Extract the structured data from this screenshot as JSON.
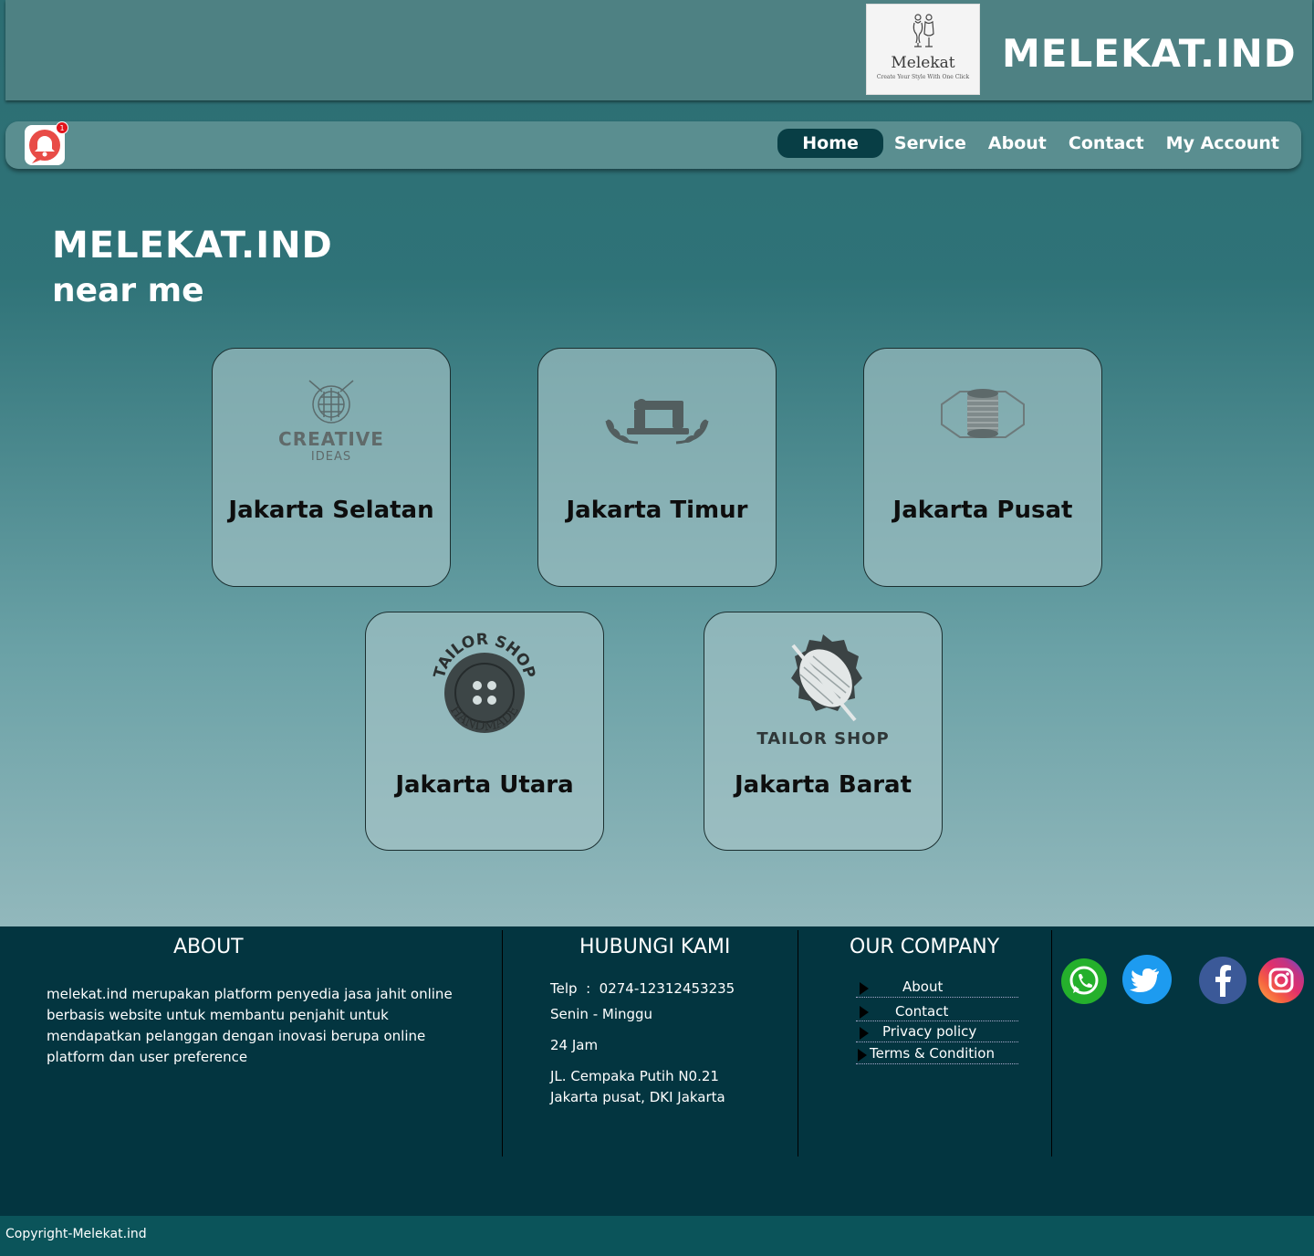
{
  "header": {
    "logo_name": "Melekat",
    "logo_tagline": "Create Your Style With One Click",
    "brand": "MELEKAT.IND"
  },
  "app": {
    "badge_count": "1"
  },
  "nav": {
    "items": [
      {
        "label": "Home",
        "active": true
      },
      {
        "label": "Service"
      },
      {
        "label": "About"
      },
      {
        "label": "Contact"
      },
      {
        "label": "My Account"
      }
    ]
  },
  "hero": {
    "title": "MELEKAT.IND",
    "subtitle": "near me"
  },
  "cards": [
    {
      "title": "Jakarta Selatan",
      "logo_text_1": "CREATIVE",
      "logo_text_2": "IDEAS"
    },
    {
      "title": "Jakarta Timur"
    },
    {
      "title": "Jakarta Pusat"
    },
    {
      "title": "Jakarta Utara",
      "logo_text_1": "TAILOR SHOP",
      "logo_text_2": "HANDMADE"
    },
    {
      "title": "Jakarta Barat",
      "logo_text_1": "TAILOR SHOP"
    }
  ],
  "footer": {
    "about": {
      "heading": "ABOUT",
      "text": "melekat.ind merupakan platform penyedia jasa jahit online berbasis website untuk membantu penjahit untuk mendapatkan pelanggan dengan inovasi berupa online platform dan user preference"
    },
    "contact": {
      "heading": "HUBUNGI KAMI",
      "phone": "Telp  :  0274-12312453235",
      "days": "Senin - Minggu",
      "hours": "24 Jam",
      "address_1": "JL. Cempaka Putih N0.21",
      "address_2": "Jakarta pusat, DKI Jakarta"
    },
    "company": {
      "heading": "OUR COMPANY",
      "links": [
        "About",
        "Contact",
        "Privacy policy",
        "Terms & Condition"
      ]
    },
    "social": [
      "whatsapp-icon",
      "twitter-icon",
      "facebook-icon",
      "instagram-icon"
    ],
    "copyright": "Copyright-Melekat.ind"
  },
  "colors": {
    "header_bg": "#4e8183",
    "nav_bg": "#5a8e90",
    "nav_active": "#083e45",
    "footer_bg": "#033540",
    "copyright_bg": "#0b545a"
  }
}
